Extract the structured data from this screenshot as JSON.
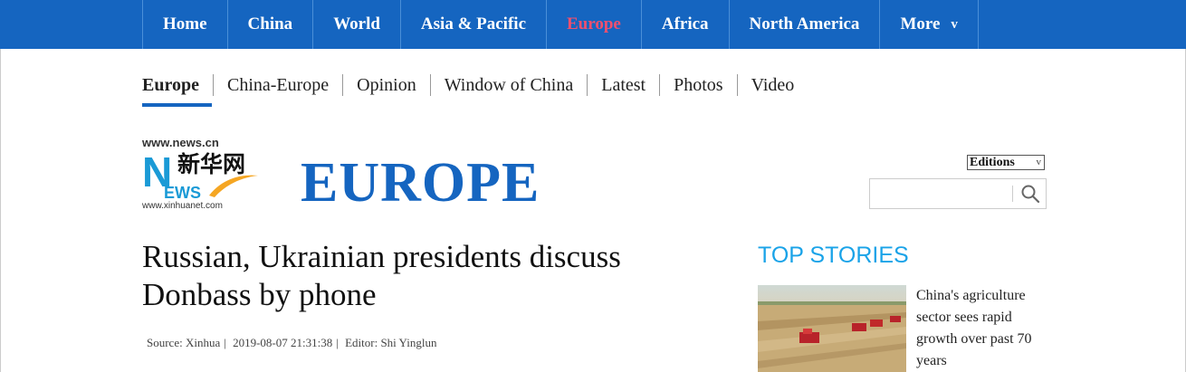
{
  "top_nav": {
    "items": [
      {
        "label": "Home"
      },
      {
        "label": "China"
      },
      {
        "label": "World"
      },
      {
        "label": "Asia & Pacific"
      },
      {
        "label": "Europe",
        "active": true
      },
      {
        "label": "Africa"
      },
      {
        "label": "North America"
      },
      {
        "label": "More",
        "chevron": "v"
      }
    ],
    "colors": {
      "background": "#1565c0",
      "active": "#f0506e"
    }
  },
  "sub_nav": {
    "items": [
      "Europe",
      "China-Europe",
      "Opinion",
      "Window of China",
      "Latest",
      "Photos",
      "Video"
    ]
  },
  "logo": {
    "url_top": "www.news.cn",
    "chinese": "新华网",
    "letters_n": "N",
    "letters_ews": "EWS",
    "url_bottom": "www.xinhuanet.com"
  },
  "section_title": "EUROPE",
  "editions": {
    "label": "Editions",
    "chevron": "v"
  },
  "search": {
    "placeholder": "",
    "icon": "search-icon"
  },
  "article": {
    "headline": "Russian, Ukrainian presidents discuss Donbass by phone",
    "source": "Source: Xinhua",
    "datetime": "2019-08-07 21:31:38",
    "editor": "Editor: Shi Yinglun"
  },
  "sidebar": {
    "heading": "TOP STORIES",
    "stories": [
      {
        "text": "China's agriculture sector sees rapid growth over past 70 years"
      }
    ]
  }
}
